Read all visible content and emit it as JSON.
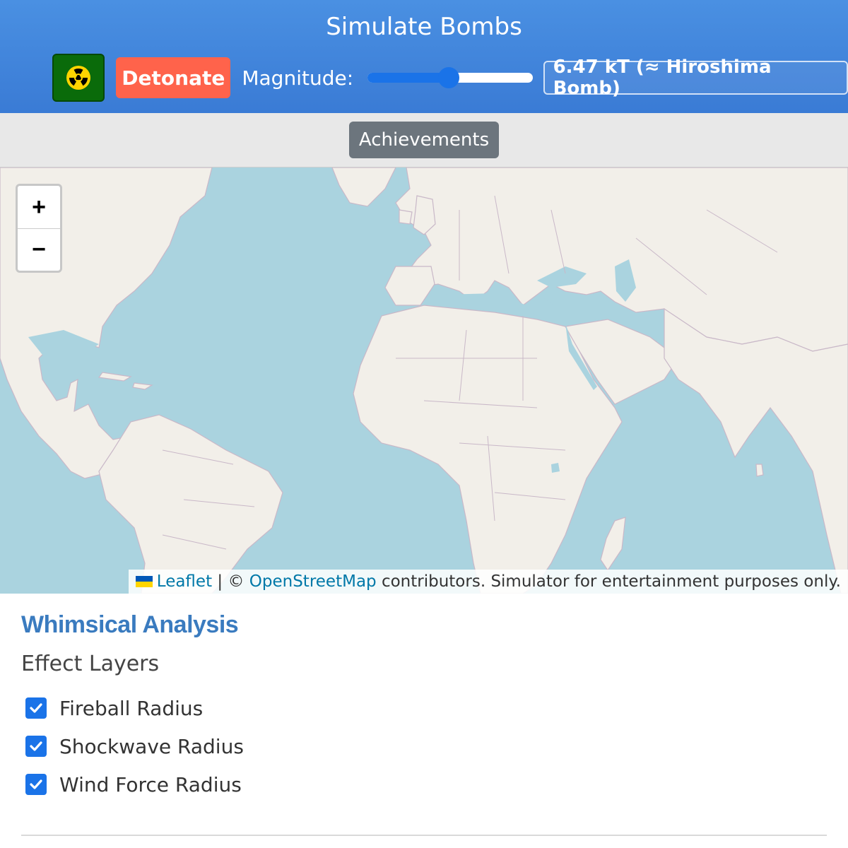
{
  "header": {
    "title": "Simulate Bombs",
    "detonate_label": "Detonate",
    "magnitude_label": "Magnitude:",
    "magnitude_fraction": 0.49,
    "yield_text": "6.47 kT (≈ Hiroshima Bomb)",
    "nuke_icon": "radiation-icon"
  },
  "nav": {
    "achievements_label": "Achievements"
  },
  "map": {
    "zoom_in": "+",
    "zoom_out": "−",
    "attribution": {
      "leaflet": "Leaflet",
      "separator": " | © ",
      "osm": "OpenStreetMap",
      "suffix": " contributors. Simulator for entertainment purposes only."
    }
  },
  "analysis": {
    "title": "Whimsical Analysis",
    "subtitle": "Effect Layers",
    "layers": [
      {
        "label": "Fireball Radius",
        "checked": true
      },
      {
        "label": "Shockwave Radius",
        "checked": true
      },
      {
        "label": "Wind Force Radius",
        "checked": true
      }
    ]
  },
  "colors": {
    "header": "#4a90e2",
    "detonate": "#ff634b",
    "water": "#aad3df",
    "land": "#f2efe9",
    "accent": "#1a73e8",
    "heading": "#3a7bbf"
  }
}
